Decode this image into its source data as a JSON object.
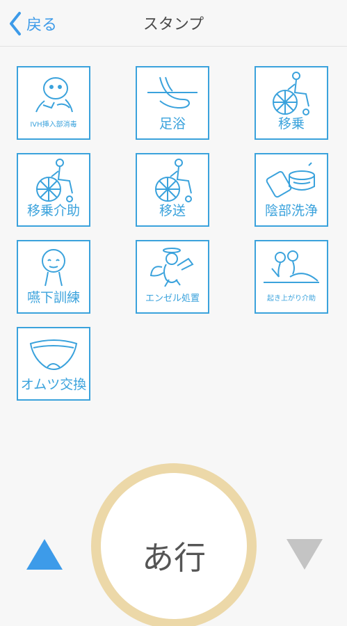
{
  "header": {
    "back_label": "戻る",
    "title": "スタンプ"
  },
  "stamps": [
    {
      "label": "IVH挿入部消毒",
      "icon": "iv-insertion-disinfect-icon"
    },
    {
      "label": "足浴",
      "icon": "foot-bath-icon"
    },
    {
      "label": "移乗",
      "icon": "wheelchair-transfer-icon"
    },
    {
      "label": "移乗介助",
      "icon": "transfer-assist-icon"
    },
    {
      "label": "移送",
      "icon": "transport-icon"
    },
    {
      "label": "陰部洗浄",
      "icon": "perineal-wash-icon"
    },
    {
      "label": "嚥下訓練",
      "icon": "swallow-training-icon"
    },
    {
      "label": "エンゼル処置",
      "icon": "angel-care-icon"
    },
    {
      "label": "起き上がり介助",
      "icon": "sit-up-assist-icon"
    },
    {
      "label": "オムツ交換",
      "icon": "diaper-change-icon"
    }
  ],
  "footer": {
    "row_label": "あ行",
    "up_icon": "arrow-up-icon",
    "down_icon": "arrow-down-icon"
  },
  "colors": {
    "accent": "#3d9be9",
    "stamp_border": "#3aa2dc",
    "dial_ring": "#ecd8a8",
    "down_arrow": "#c4c4c4"
  }
}
